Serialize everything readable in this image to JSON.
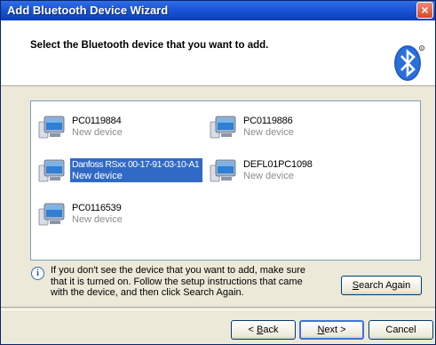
{
  "window": {
    "title": "Add Bluetooth Device Wizard",
    "close_glyph": "×"
  },
  "header": {
    "heading": "Select the Bluetooth device that you want to add."
  },
  "devices": [
    {
      "name": "PC0119884",
      "status": "New device",
      "selected": false
    },
    {
      "name": "PC0119886",
      "status": "New device",
      "selected": false
    },
    {
      "name": "Danfoss RSxx 00-17-91-03-10-A1",
      "status": "New device",
      "selected": true
    },
    {
      "name": "DEFL01PC1098",
      "status": "New device",
      "selected": false
    },
    {
      "name": "PC0116539",
      "status": "New device",
      "selected": false
    }
  ],
  "info": {
    "icon": "i",
    "text": "If you don't see the device that you want to add, make sure that it is turned on. Follow the setup instructions that came with the device, and then click Search Again."
  },
  "buttons": {
    "search_again": {
      "accel": "S",
      "rest": "earch Again"
    },
    "back": {
      "prefix": "< ",
      "accel": "B",
      "rest": "ack"
    },
    "next": {
      "accel": "N",
      "rest": "ext >"
    },
    "cancel": "Cancel"
  },
  "colors": {
    "title_bar": "#1c57d8",
    "selection": "#316ac5",
    "dialog_bg": "#ece9d8"
  },
  "icons": [
    "close-icon",
    "bluetooth-logo-icon",
    "computer-icon",
    "info-icon"
  ]
}
